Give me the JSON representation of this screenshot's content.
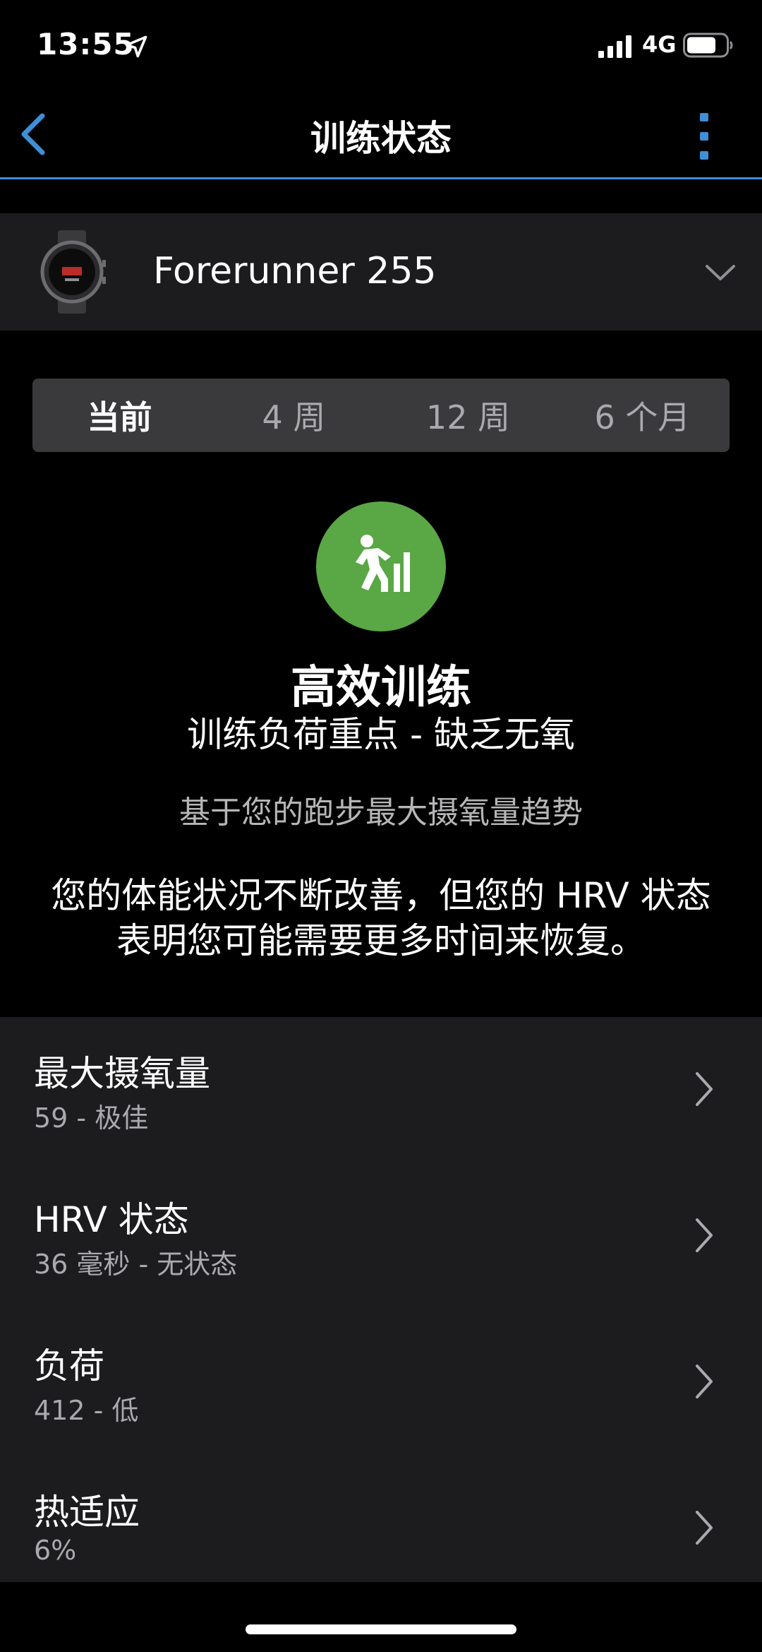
{
  "status_bar": {
    "time": "13:55",
    "network": "4G",
    "icons": [
      "location-arrow-icon",
      "signal-icon",
      "battery-icon"
    ]
  },
  "nav": {
    "title": "训练状态",
    "icons": [
      "back-chevron-icon",
      "more-vertical-icon"
    ],
    "accent": "#3f8fd6"
  },
  "device": {
    "name": "Forerunner 255",
    "icon": "watch-icon"
  },
  "tabs": [
    {
      "label": "当前",
      "active": true
    },
    {
      "label": "4 周",
      "active": false
    },
    {
      "label": "12 周",
      "active": false
    },
    {
      "label": "6 个月",
      "active": false
    }
  ],
  "training_status": {
    "title": "高效训练",
    "subtitle": "训练负荷重点 - 缺乏无氧",
    "basis": "基于您的跑步最大摄氧量趋势",
    "description": "您的体能状况不断改善，但您的 HRV 状态表明您可能需要更多时间来恢复。",
    "icon": "runner-bars-icon",
    "color": "#5aa745"
  },
  "metrics": [
    {
      "title": "最大摄氧量",
      "value": "59 - 极佳"
    },
    {
      "title": "HRV 状态",
      "value": "36 毫秒 - 无状态"
    },
    {
      "title": "负荷",
      "value": "412 - 低"
    },
    {
      "title": "热适应",
      "value": "6%"
    }
  ]
}
